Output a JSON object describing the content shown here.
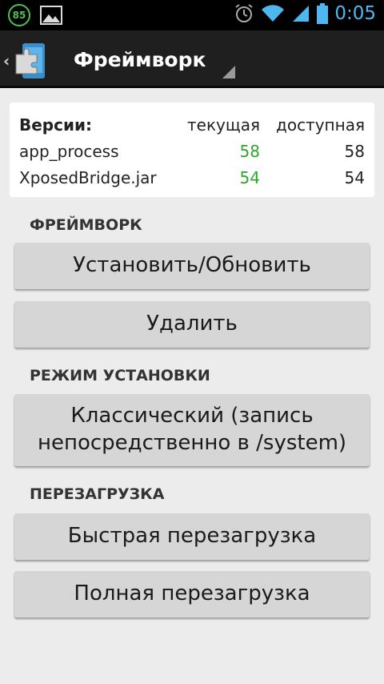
{
  "status_bar": {
    "notification_badge": "85",
    "time": "0:05"
  },
  "action_bar": {
    "title": "Фреймворк"
  },
  "versions": {
    "header": {
      "label": "Версии:",
      "current": "текущая",
      "available": "доступная"
    },
    "rows": [
      {
        "name": "app_process",
        "current": "58",
        "available": "58"
      },
      {
        "name": "XposedBridge.jar",
        "current": "54",
        "available": "54"
      }
    ]
  },
  "sections": {
    "framework": {
      "title": "ФРЕЙМВОРК",
      "install_label": "Установить/Обновить",
      "uninstall_label": "Удалить"
    },
    "install_mode": {
      "title": "РЕЖИМ УСТАНОВКИ",
      "selected_line1": "Классический (запись",
      "selected_line2": "непосредственно в /system)"
    },
    "reboot": {
      "title": "ПЕРЕЗАГРУЗКА",
      "soft_label": "Быстрая перезагрузка",
      "full_label": "Полная перезагрузка"
    }
  },
  "colors": {
    "accent_clock": "#4fb7f0",
    "version_green": "#2ea52e",
    "badge_green": "#4ec24e"
  }
}
